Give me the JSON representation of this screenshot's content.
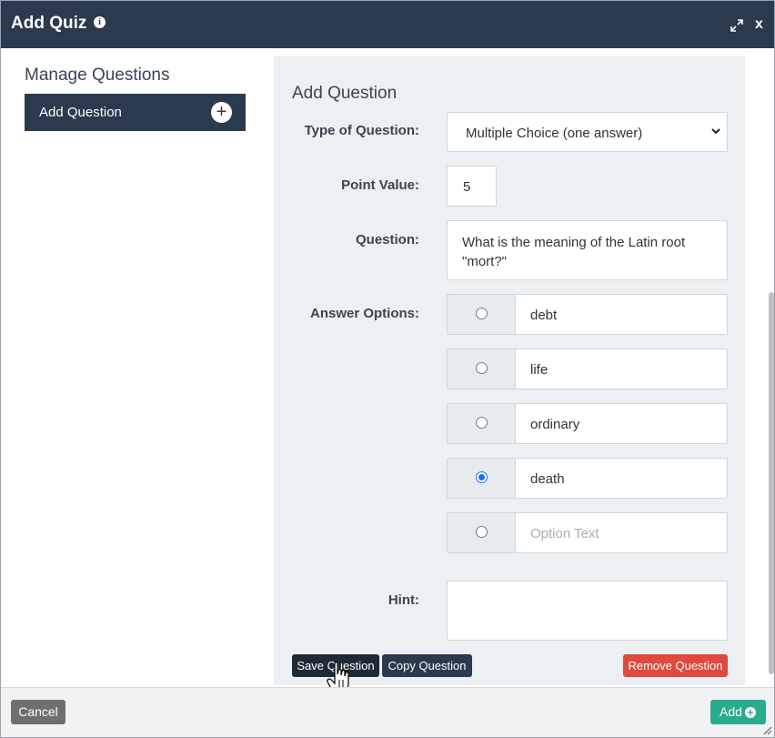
{
  "window": {
    "title": "Add Quiz",
    "info_icon": "info-icon",
    "expand_icon": "expand-icon",
    "close_label": "x"
  },
  "sidebar": {
    "title": "Manage Questions",
    "items": [
      {
        "label": "Add Question",
        "icon": "plus-circle-icon"
      }
    ]
  },
  "form": {
    "title": "Add Question",
    "type_label": "Type of Question:",
    "type_value": "Multiple Choice (one answer)",
    "points_label": "Point Value:",
    "points_value": "5",
    "question_label": "Question:",
    "question_value": "What is the meaning of the Latin root \"mort?\"",
    "answers_label": "Answer Options:",
    "options": [
      {
        "text": "debt",
        "selected": false
      },
      {
        "text": "life",
        "selected": false
      },
      {
        "text": "ordinary",
        "selected": false
      },
      {
        "text": "death",
        "selected": true
      },
      {
        "text": "",
        "placeholder": "Option Text",
        "selected": false
      }
    ],
    "hint_label": "Hint:",
    "hint_value": ""
  },
  "actions": {
    "save_label": "Save Question",
    "copy_label": "Copy Question",
    "remove_label": "Remove Question"
  },
  "footer": {
    "cancel_label": "Cancel",
    "add_label": "Add"
  },
  "colors": {
    "header": "#2b3a4d",
    "panel": "#edf0f2",
    "remove": "#e0493d",
    "add": "#2aab8c",
    "radio_selected": "#1a73e8"
  }
}
